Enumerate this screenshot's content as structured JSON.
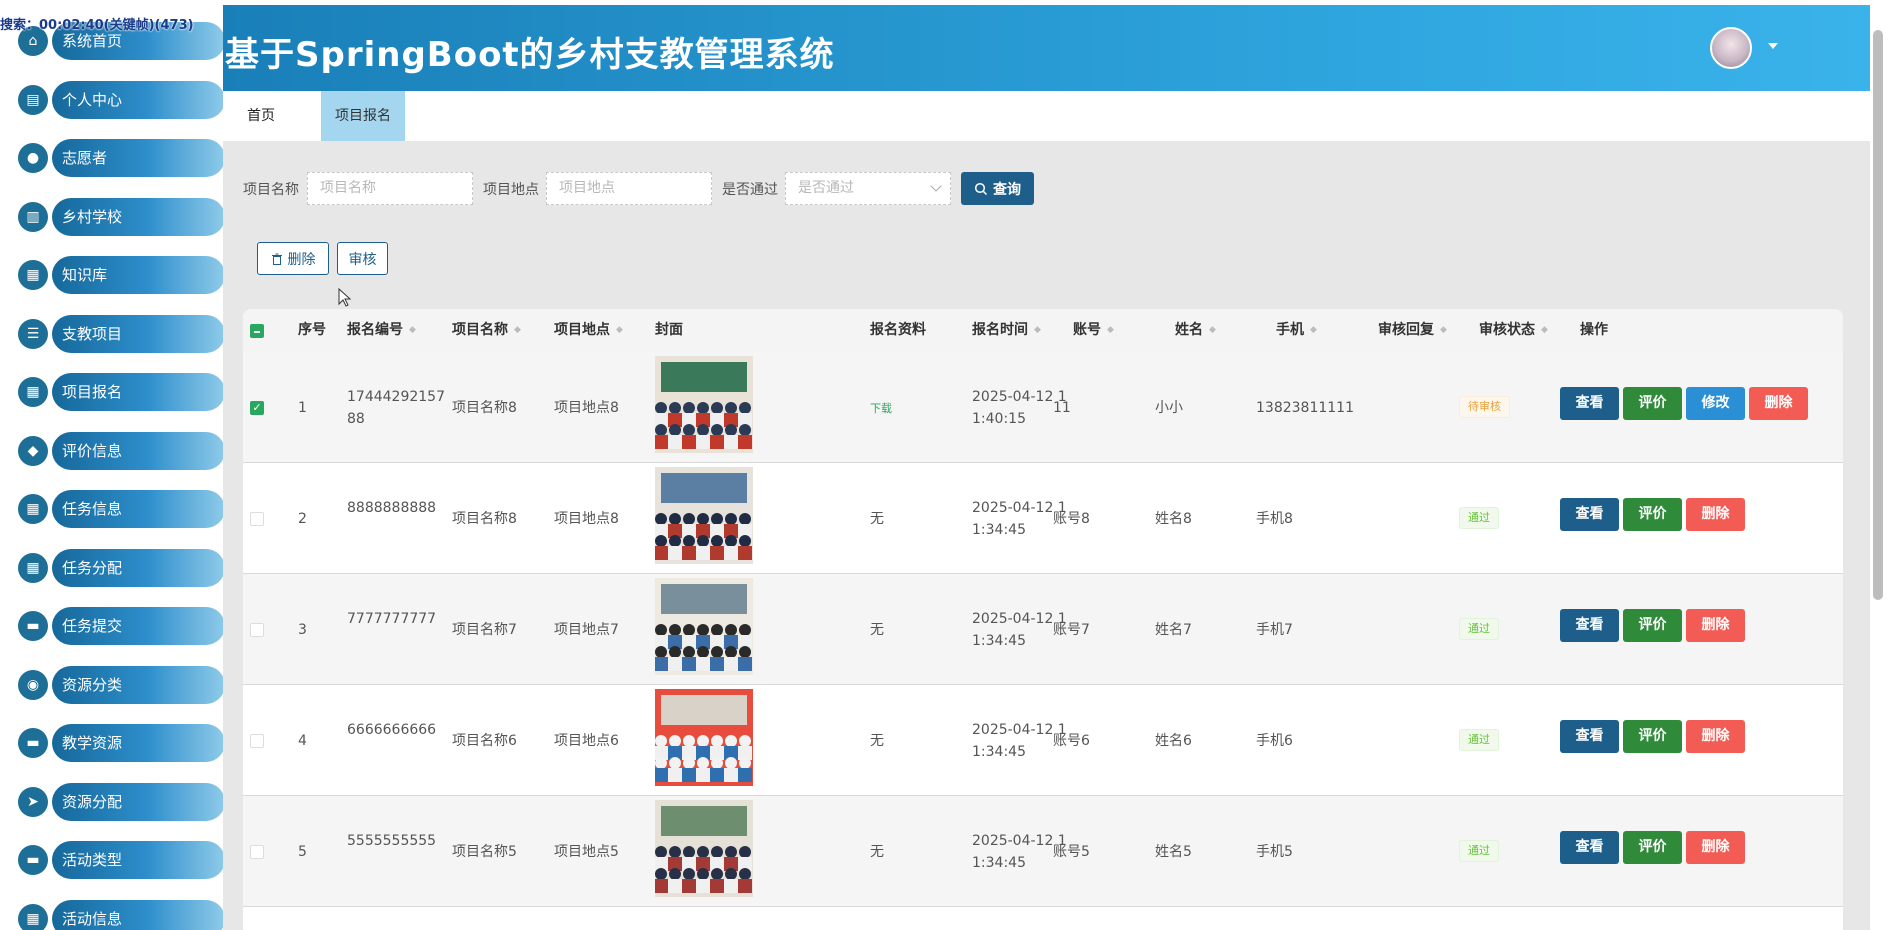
{
  "overlay_text": "搜索：00:02:40(关键帧)(473)",
  "app_title": "基于SpringBoot的乡村支教管理系统",
  "sidebar": [
    {
      "label": "系统首页",
      "icon": "home-icon",
      "glyph": "⌂"
    },
    {
      "label": "个人中心",
      "icon": "card-icon",
      "glyph": "▤"
    },
    {
      "label": "志愿者",
      "icon": "bulb-icon",
      "glyph": "●"
    },
    {
      "label": "乡村学校",
      "icon": "building-icon",
      "glyph": "▥"
    },
    {
      "label": "知识库",
      "icon": "grid-icon",
      "glyph": "▦"
    },
    {
      "label": "支教项目",
      "icon": "sliders-icon",
      "glyph": "☰"
    },
    {
      "label": "项目报名",
      "icon": "grid-icon",
      "glyph": "▦"
    },
    {
      "label": "评价信息",
      "icon": "thumb-icon",
      "glyph": "◆"
    },
    {
      "label": "任务信息",
      "icon": "grid-icon",
      "glyph": "▦"
    },
    {
      "label": "任务分配",
      "icon": "grid-icon",
      "glyph": "▦"
    },
    {
      "label": "任务提交",
      "icon": "monitor-icon",
      "glyph": "▬"
    },
    {
      "label": "资源分类",
      "icon": "user-icon",
      "glyph": "◉"
    },
    {
      "label": "教学资源",
      "icon": "screen-icon",
      "glyph": "▬"
    },
    {
      "label": "资源分配",
      "icon": "send-icon",
      "glyph": "➤"
    },
    {
      "label": "活动类型",
      "icon": "monitor-icon",
      "glyph": "▬"
    },
    {
      "label": "活动信息",
      "icon": "grid-icon",
      "glyph": "▦"
    }
  ],
  "tabs": [
    "首页",
    "项目报名"
  ],
  "search": {
    "name_label": "项目名称",
    "name_placeholder": "项目名称",
    "place_label": "项目地点",
    "place_placeholder": "项目地点",
    "pass_label": "是否通过",
    "pass_placeholder": "是否通过",
    "query_label": "查询"
  },
  "toolbar": {
    "delete_label": "删除",
    "audit_label": "审核"
  },
  "columns": [
    "序号",
    "报名编号",
    "项目名称",
    "项目地点",
    "封面",
    "报名资料",
    "报名时间",
    "账号",
    "姓名",
    "手机",
    "审核回复",
    "审核状态",
    "操作"
  ],
  "rows": [
    {
      "checked": true,
      "no": "1",
      "code": "17444292157 88",
      "name": "项目名称8",
      "place": "项目地点8",
      "material": "下载",
      "time": "2025-04-12 1 1:40:15",
      "account": "11",
      "person": "小小",
      "phone": "13823811111",
      "reply": "",
      "status": "待审核",
      "status_type": "pending",
      "actions": [
        "查看",
        "评价",
        "修改",
        "删除"
      ]
    },
    {
      "checked": false,
      "no": "2",
      "code": "8888888888",
      "name": "项目名称8",
      "place": "项目地点8",
      "material": "无",
      "time": "2025-04-12 1 1:34:45",
      "account": "账号8",
      "person": "姓名8",
      "phone": "手机8",
      "reply": "",
      "status": "通过",
      "status_type": "pass",
      "actions": [
        "查看",
        "评价",
        "删除"
      ]
    },
    {
      "checked": false,
      "no": "3",
      "code": "7777777777",
      "name": "项目名称7",
      "place": "项目地点7",
      "material": "无",
      "time": "2025-04-12 1 1:34:45",
      "account": "账号7",
      "person": "姓名7",
      "phone": "手机7",
      "reply": "",
      "status": "通过",
      "status_type": "pass",
      "actions": [
        "查看",
        "评价",
        "删除"
      ]
    },
    {
      "checked": false,
      "no": "4",
      "code": "6666666666",
      "name": "项目名称6",
      "place": "项目地点6",
      "material": "无",
      "time": "2025-04-12 1 1:34:45",
      "account": "账号6",
      "person": "姓名6",
      "phone": "手机6",
      "reply": "",
      "status": "通过",
      "status_type": "pass",
      "actions": [
        "查看",
        "评价",
        "删除"
      ]
    },
    {
      "checked": false,
      "no": "5",
      "code": "5555555555",
      "name": "项目名称5",
      "place": "项目地点5",
      "material": "无",
      "time": "2025-04-12 1 1:34:45",
      "account": "账号5",
      "person": "姓名5",
      "phone": "手机5",
      "reply": "",
      "status": "通过",
      "status_type": "pass",
      "actions": [
        "查看",
        "评价",
        "删除"
      ]
    }
  ],
  "colors": {
    "header": "#2fa6df",
    "primary": "#1d5f8a",
    "rate": "#2f8a3a",
    "edit": "#2a8fd4",
    "danger": "#f25c55",
    "check": "#27a85e"
  }
}
